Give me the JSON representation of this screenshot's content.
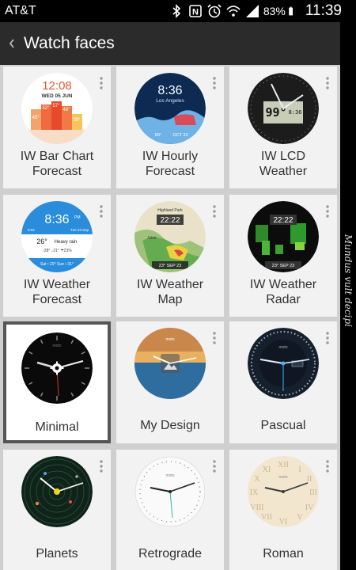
{
  "status_bar": {
    "carrier": "AT&T",
    "battery_percent": "83%",
    "time": "11:39",
    "icons": [
      "bluetooth-icon",
      "nfc-icon",
      "alarm-icon",
      "wifi-icon",
      "signal-icon",
      "battery-icon"
    ]
  },
  "action_bar": {
    "back_icon": "chevron-left-icon",
    "title": "Watch faces"
  },
  "watch_faces": [
    {
      "label_line1": "IW Bar Chart",
      "label_line2": "Forecast",
      "selected": false,
      "face_text": {
        "time": "12:08",
        "date": "WED 05 JUN",
        "t1": "45°",
        "t2": "52°",
        "t3": "57°",
        "t4": "48°",
        "t5": "39°"
      }
    },
    {
      "label_line1": "IW Hourly",
      "label_line2": "Forecast",
      "selected": false,
      "face_text": {
        "time": "8:36",
        "city": "Los Angeles",
        "footer_left": "83°",
        "footer_right": "OCT 23"
      }
    },
    {
      "label_line1": "IW LCD",
      "label_line2": "Weather",
      "selected": false,
      "face_text": {
        "temp": "99°",
        "time": "8:36"
      }
    },
    {
      "label_line1": "IW Weather",
      "label_line2": "Forecast",
      "selected": false,
      "face_text": {
        "time": "8:36",
        "ampm": "PM",
        "side_left": "8:04",
        "side_right": "Tue 23 Sep",
        "temp": "26°",
        "condition": "Heavy rain",
        "details": "↑28° ↓21° ☂23%",
        "forecast": "Sat • 29°  Sun • 31°"
      }
    },
    {
      "label_line1": "IW Weather",
      "label_line2": "Map",
      "selected": false,
      "face_text": {
        "place1": "Highland Park",
        "time": "22:22",
        "place2": "Joliet",
        "footer": "23° SEP 23"
      }
    },
    {
      "label_line1": "IW Weather",
      "label_line2": "Radar",
      "selected": false,
      "face_text": {
        "time": "22:22",
        "footer": "23° SEP 23"
      }
    },
    {
      "label_line1": "Minimal",
      "label_line2": "",
      "selected": true,
      "face_text": {
        "brand": "moto"
      }
    },
    {
      "label_line1": "My Design",
      "label_line2": "",
      "selected": false,
      "face_text": {
        "brand": "moto"
      }
    },
    {
      "label_line1": "Pascual",
      "label_line2": "",
      "selected": false,
      "face_text": {
        "brand": "moto"
      }
    },
    {
      "label_line1": "Planets",
      "label_line2": "",
      "selected": false,
      "face_text": {}
    },
    {
      "label_line1": "Retrograde",
      "label_line2": "",
      "selected": false,
      "face_text": {
        "brand": "moto"
      }
    },
    {
      "label_line1": "Roman",
      "label_line2": "",
      "selected": false,
      "face_text": {
        "brand": "moto"
      }
    }
  ],
  "watermark": "Mundus vult decipi",
  "colors": {
    "action_bar": "#2b2b2b",
    "grid_background": "#cfcfcf",
    "tile": "#f2f2f2",
    "selected_border": "#555555"
  }
}
